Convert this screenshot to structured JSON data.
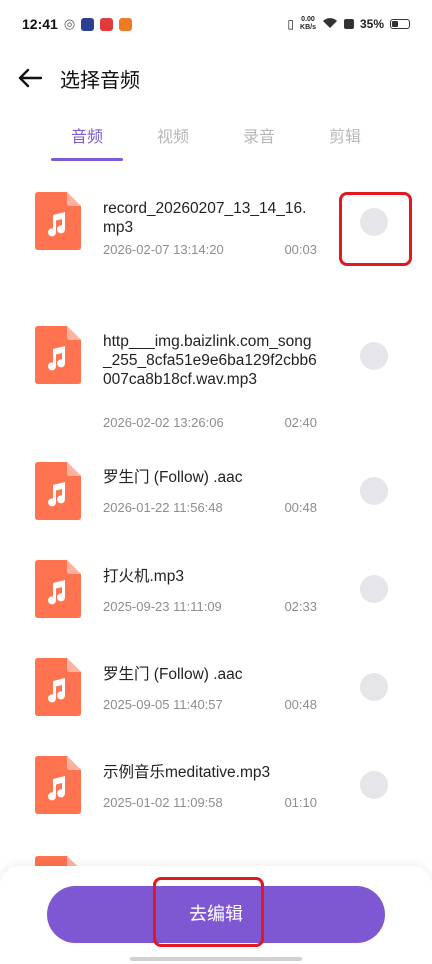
{
  "status": {
    "time": "12:41",
    "net_speed_value": "0.00",
    "net_speed_unit": "KB/s",
    "battery": "35%",
    "battery_level": 0.35
  },
  "header": {
    "title": "选择音频"
  },
  "tabs": [
    {
      "label": "音频",
      "active": true
    },
    {
      "label": "视频",
      "active": false
    },
    {
      "label": "录音",
      "active": false
    },
    {
      "label": "剪辑",
      "active": false
    }
  ],
  "files": [
    {
      "name": "record_20260207_13_14_16.mp3",
      "date": "2026-02-07 13:14:20",
      "duration": "00:03"
    },
    {
      "name": "http___img.baizlink.com_song_255_8cfa51e9e6ba129f2cbb6007ca8b18cf.wav.mp3",
      "date": "2026-02-02 13:26:06",
      "duration": "02:40"
    },
    {
      "name": "罗生门 (Follow) .aac",
      "date": "2026-01-22 11:56:48",
      "duration": "00:48"
    },
    {
      "name": "打火机.mp3",
      "date": "2025-09-23 11:11:09",
      "duration": "02:33"
    },
    {
      "name": "罗生门 (Follow) .aac",
      "date": "2025-09-05 11:40:57",
      "duration": "00:48"
    },
    {
      "name": "示例音乐meditative.mp3",
      "date": "2025-01-02 11:09:58",
      "duration": "01:10"
    }
  ],
  "bottom": {
    "edit_label": "去编辑"
  },
  "colors": {
    "accent": "#7e57d2",
    "file_icon": "#ff7350",
    "highlight": "#e0191f"
  }
}
